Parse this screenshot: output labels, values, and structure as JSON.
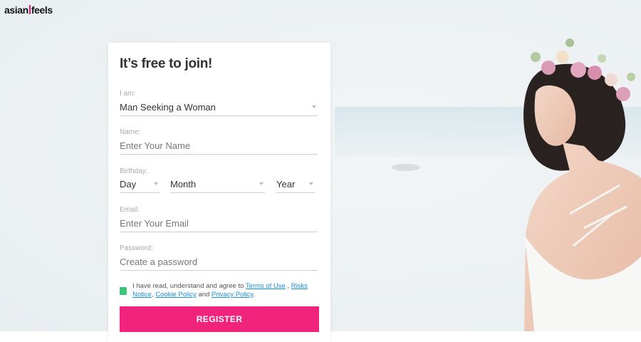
{
  "brand": {
    "logo_left": "asian",
    "logo_right": "feels",
    "accent": "#f0247d"
  },
  "form": {
    "title": "It’s free to join!",
    "iam_label": "I am:",
    "iam_value": "Man Seeking a Woman",
    "name_label": "Name:",
    "name_placeholder": "Enter Your Name",
    "birthday_label": "Birthday:",
    "day_value": "Day",
    "month_value": "Month",
    "year_value": "Year",
    "email_label": "Email:",
    "email_placeholder": "Enter Your Email",
    "password_label": "Password:",
    "password_placeholder": "Create a password",
    "agree_prefix": "I have read, understand and agree to",
    "terms_link": "Terms of Use",
    "sep1": " , ",
    "risks_link": "Risks Notice",
    "sep2": ", ",
    "cookie_link": "Cookie Policy",
    "and": " and ",
    "privacy_link": "Privacy Policy",
    "period": ".",
    "register_label": "REGISTER",
    "checkbox_color": "#3ec57a"
  }
}
